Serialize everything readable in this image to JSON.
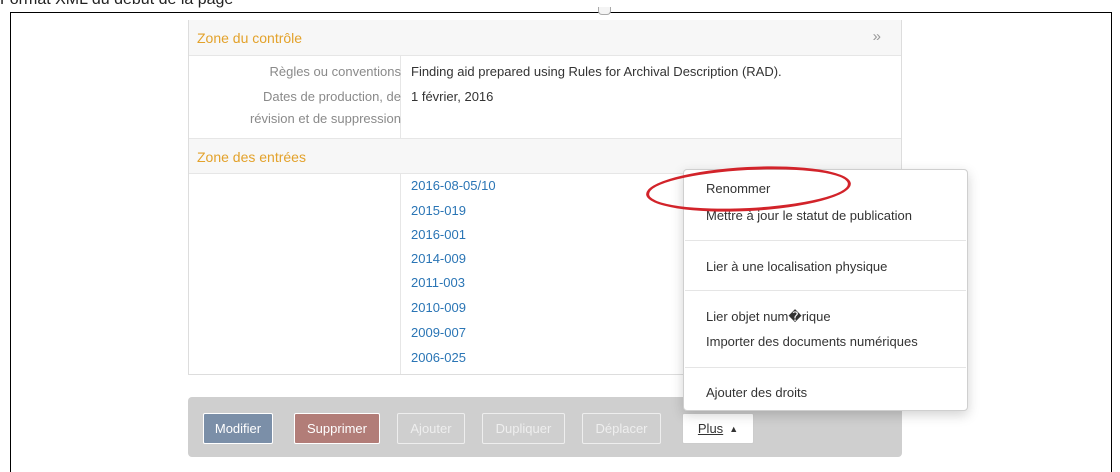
{
  "document": {
    "title": "Format XML du début de la page"
  },
  "control_zone": {
    "heading": "Zone du contrôle",
    "toggle_icon": "»",
    "fields": [
      {
        "label": "Règles ou conventions",
        "value": "Finding aid prepared using Rules for Archival Description (RAD)."
      },
      {
        "label_line1": "Dates de production, de",
        "label_line2": "révision et de suppression",
        "value": "1 février, 2016"
      }
    ]
  },
  "entries_zone": {
    "heading": "Zone des entrées",
    "links": [
      "2016-08-05/10",
      "2015-019",
      "2016-001",
      "2014-009",
      "2011-003",
      "2010-009",
      "2009-007",
      "2006-025"
    ]
  },
  "toolbar": {
    "edit_label": "Modifier",
    "delete_label": "Supprimer",
    "add_label": "Ajouter",
    "duplicate_label": "Dupliquer",
    "move_label": "Déplacer",
    "more_label": "Plus",
    "more_icon": "caret-up-icon"
  },
  "more_menu": {
    "items": [
      "Renommer",
      "Mettre à jour le statut de publication",
      "Lier à une localisation physique",
      "Lier objet num�rique",
      "Importer des documents numériques",
      "Ajouter des droits"
    ]
  },
  "annotation": {
    "color": "#d2232a",
    "target": "Renommer"
  },
  "colors": {
    "section_heading": "#e3a22b",
    "link": "#2a75b5",
    "toolbar_bg": "#cfcfcf",
    "edit_button": "#7b8fa8",
    "delete_button": "#b27d78"
  }
}
